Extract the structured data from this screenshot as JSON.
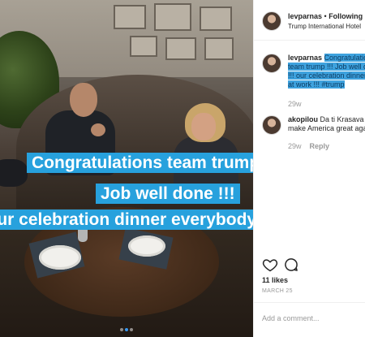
{
  "post": {
    "caption_overlay": [
      "Congratulations team trump !!!",
      "Job well done !!!",
      "ng our celebration dinner everybody hard at"
    ],
    "carousel": {
      "count": 3,
      "active_index": 1
    }
  },
  "panel": {
    "header": {
      "username": "levparnas",
      "separator": " • ",
      "follow_label": "Following",
      "location": "Trump International Hotel"
    },
    "comments": [
      {
        "username": "levparnas",
        "text": "Congratulations team trump !!! Job well done !!! our celebration dinner hard at work !!! #trump",
        "time": "29w",
        "highlighted": true
      },
      {
        "username": "akopilou",
        "text": "Da ti Krasava make America great again",
        "time": "29w",
        "reply_label": "Reply"
      }
    ],
    "actions": {
      "like_icon": "heart-icon",
      "comment_icon": "speech-bubble-icon"
    },
    "likes": "11 likes",
    "date": "MARCH 25",
    "add_comment_placeholder": "Add a comment..."
  },
  "colors": {
    "caption_bg": "#27a1dd",
    "highlight_bg": "#3ea2de",
    "muted_text": "#999999",
    "carousel_active": "#3897f0"
  }
}
